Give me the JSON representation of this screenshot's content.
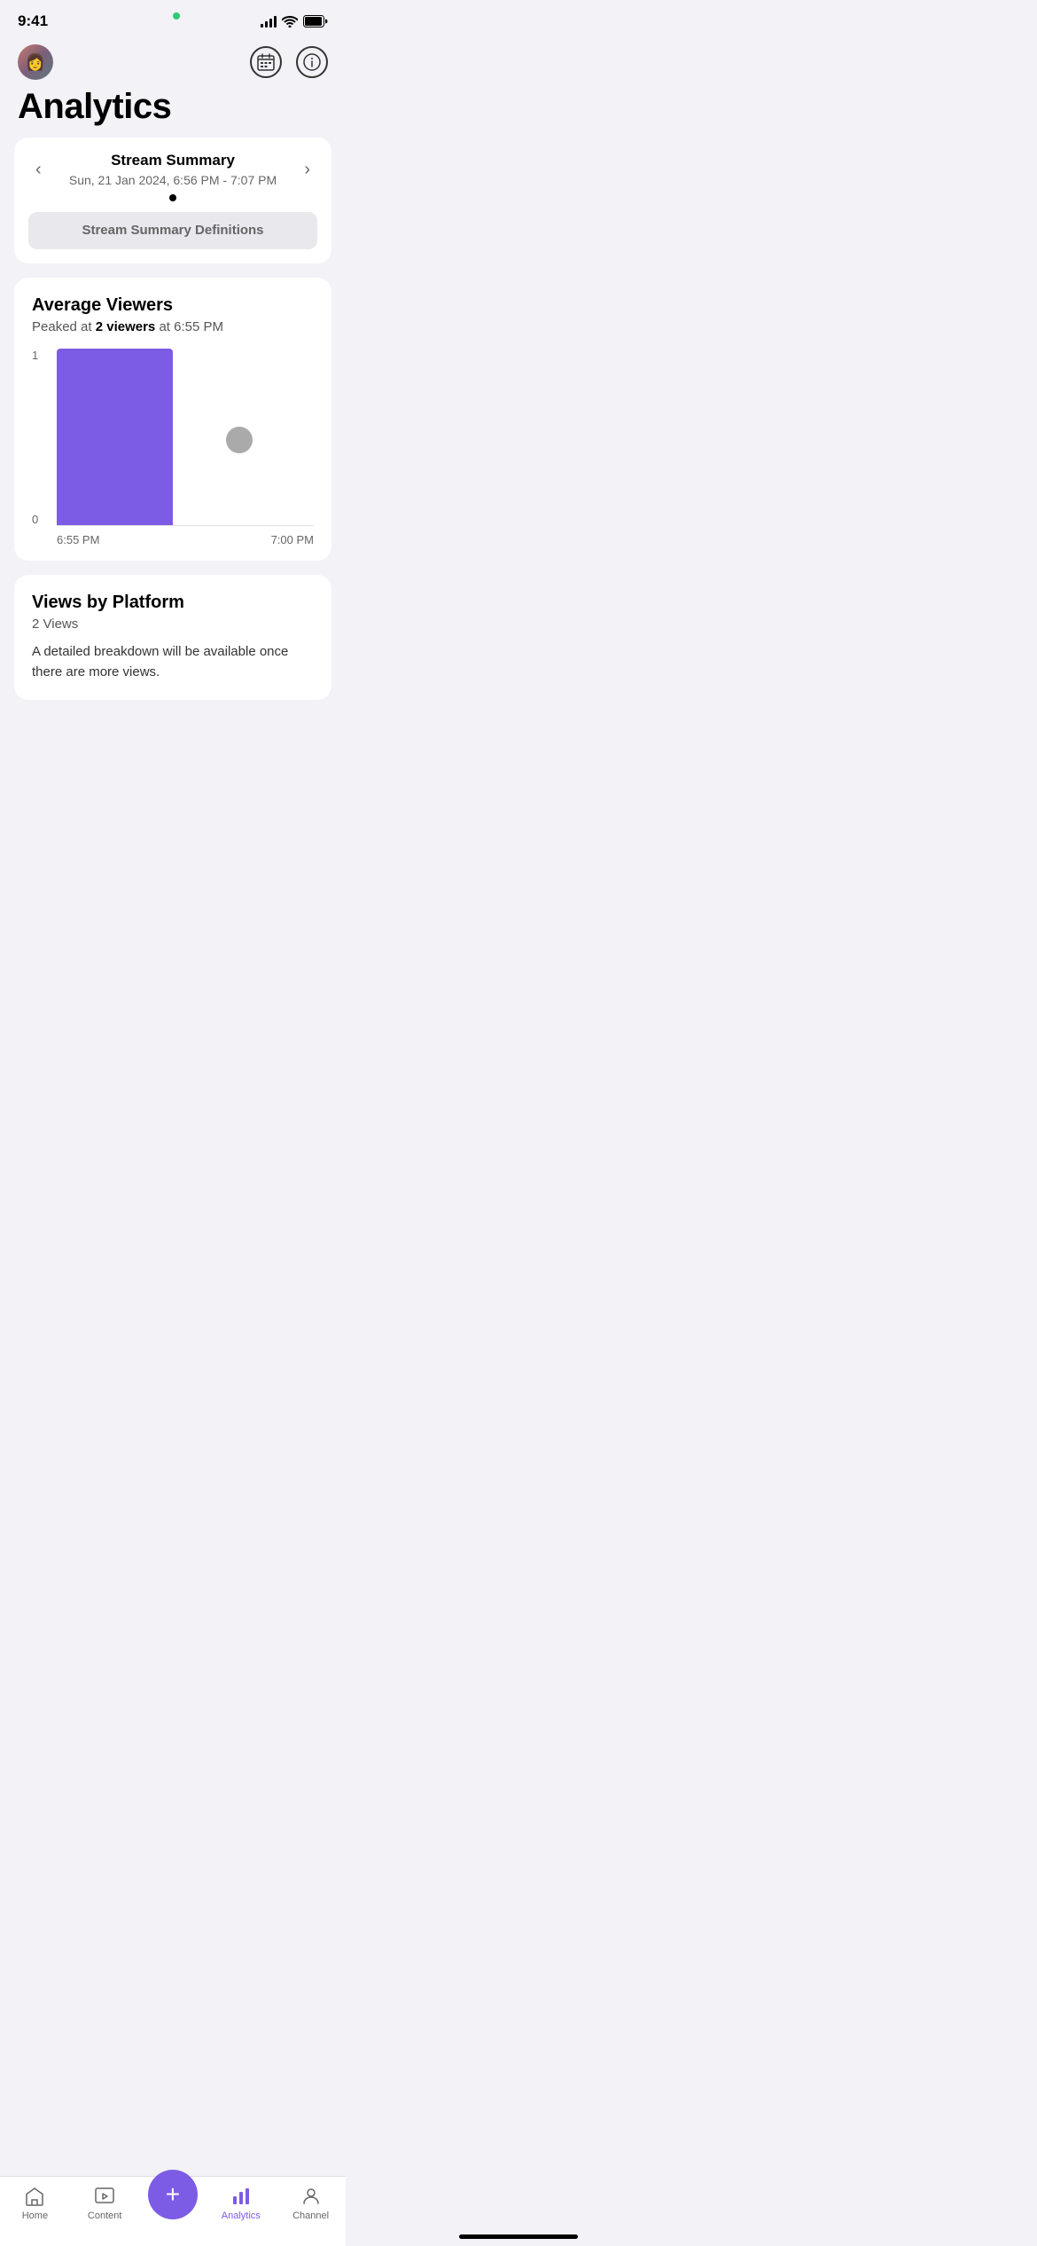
{
  "statusBar": {
    "time": "9:41",
    "greenDot": true
  },
  "header": {
    "calendarIconLabel": "calendar",
    "infoIconLabel": "info"
  },
  "pageTitle": "Analytics",
  "streamSummary": {
    "title": "Stream Summary",
    "date": "Sun, 21 Jan 2024, 6:56 PM - 7:07 PM",
    "definitionsBtn": "Stream Summary Definitions"
  },
  "averageViewers": {
    "title": "Average Viewers",
    "subtitle_prefix": "Peaked at ",
    "peak_value": "2 viewers",
    "subtitle_suffix": " at 6:55 PM",
    "yLabels": [
      "1",
      "0"
    ],
    "xLabels": [
      "6:55 PM",
      "7:00 PM"
    ]
  },
  "viewsByPlatform": {
    "title": "Views by Platform",
    "subtitle": "2 Views",
    "description": "A detailed breakdown will be available once there are more views."
  },
  "bottomNav": {
    "items": [
      {
        "id": "home",
        "label": "Home",
        "active": false
      },
      {
        "id": "content",
        "label": "Content",
        "active": false
      },
      {
        "id": "add",
        "label": "",
        "active": false
      },
      {
        "id": "analytics",
        "label": "Analytics",
        "active": true
      },
      {
        "id": "channel",
        "label": "Channel",
        "active": false
      }
    ]
  }
}
